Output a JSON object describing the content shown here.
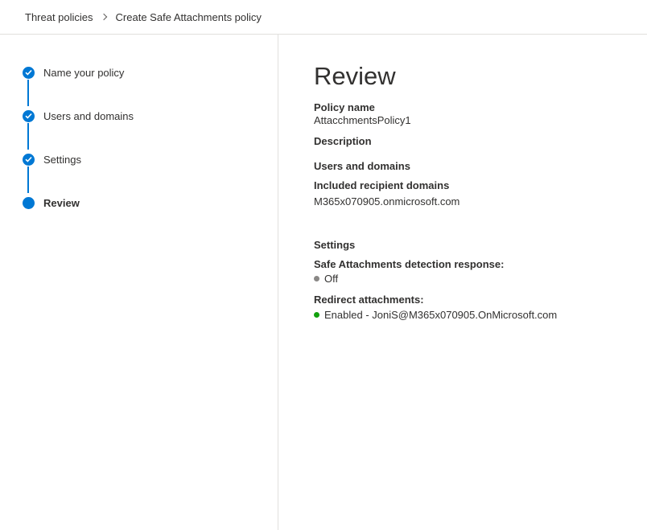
{
  "breadcrumb": {
    "parent": "Threat policies",
    "current": "Create Safe Attachments policy"
  },
  "steps": [
    {
      "label": "Name your policy",
      "state": "completed"
    },
    {
      "label": "Users and domains",
      "state": "completed"
    },
    {
      "label": "Settings",
      "state": "completed"
    },
    {
      "label": "Review",
      "state": "active"
    }
  ],
  "review": {
    "title": "Review",
    "policy_name_label": "Policy name",
    "policy_name_value": "AttacchmentsPolicy1",
    "description_label": "Description",
    "users_domains_heading": "Users and domains",
    "included_domains_label": "Included recipient domains",
    "included_domains_value": "M365x070905.onmicrosoft.com",
    "settings_heading": "Settings",
    "detection_response_label": "Safe Attachments detection response:",
    "detection_response_value": "Off",
    "detection_response_color": "#8a8886",
    "redirect_label": "Redirect attachments:",
    "redirect_value": "Enabled - JoniS@M365x070905.OnMicrosoft.com",
    "redirect_color": "#13a10e"
  },
  "colors": {
    "accent": "#0078d4"
  }
}
